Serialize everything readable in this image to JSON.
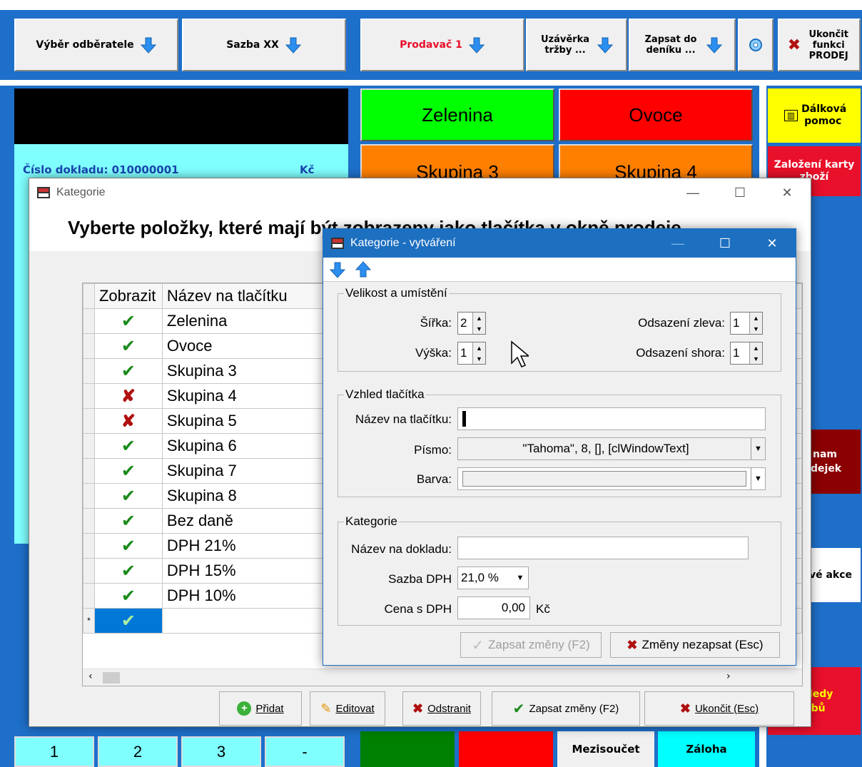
{
  "toolbar": {
    "customer": "Výběr odběratele",
    "rate": "Sazba XX",
    "seller": "Prodavač 1",
    "closing": "Uzávěrka tržby ...",
    "journal": "Zapsat do deníku ...",
    "exit": "Ukončit funkci PRODEJ"
  },
  "doc": {
    "number_label": "Číslo dokladu: 010000001",
    "currency": "Kč"
  },
  "categories_bg": [
    "Zelenina",
    "Ovoce",
    "Skupina 3",
    "Skupina 4"
  ],
  "side": {
    "remote": "Dálková pomoc",
    "card": "Založení karty zboží",
    "sales_partial": "nam dejek",
    "actions_partial": "vé akce",
    "errors_partial": "hledy ybů"
  },
  "bottom_keys": [
    "1",
    "2",
    "3",
    "-"
  ],
  "bottom_labels": {
    "subtotal": "Mezisoučet",
    "deposit": "Záloha"
  },
  "kategorie_window": {
    "title": "Kategorie",
    "heading": "Vyberte položky, které mají být zobrazeny jako tlačítka v okně prodeje",
    "col_show": "Zobrazit",
    "col_name": "Název na tlačítku",
    "rows": [
      {
        "show": true,
        "name": "Zelenina"
      },
      {
        "show": true,
        "name": "Ovoce"
      },
      {
        "show": true,
        "name": "Skupina 3"
      },
      {
        "show": false,
        "name": "Skupina 4"
      },
      {
        "show": false,
        "name": "Skupina 5"
      },
      {
        "show": true,
        "name": "Skupina 6"
      },
      {
        "show": true,
        "name": "Skupina 7"
      },
      {
        "show": true,
        "name": "Skupina 8"
      },
      {
        "show": true,
        "name": "Bez daně"
      },
      {
        "show": true,
        "name": "DPH 21%"
      },
      {
        "show": true,
        "name": "DPH 15%"
      },
      {
        "show": true,
        "name": "DPH 10%"
      }
    ],
    "new_row_marker": "*",
    "buttons": {
      "add": "Přidat",
      "edit": "Editovat",
      "delete": "Odstranit",
      "save": "Zapsat změny (F2)",
      "close": "Ukončit (Esc)"
    }
  },
  "create_window": {
    "title": "Kategorie - vytváření",
    "size_group": "Velikost a umístění",
    "width_label": "Šířka:",
    "width_value": "2",
    "height_label": "Výška:",
    "height_value": "1",
    "left_label": "Odsazení zleva:",
    "left_value": "1",
    "top_label": "Odsazení shora:",
    "top_value": "1",
    "look_group": "Vzhled tlačítka",
    "btn_name_label": "Název na tlačítku:",
    "font_label": "Písmo:",
    "font_value": "\"Tahoma\", 8, [], [clWindowText]",
    "color_label": "Barva:",
    "cat_group": "Kategorie",
    "doc_name_label": "Název na dokladu:",
    "vat_label": "Sazba DPH",
    "vat_value": "21,0 %",
    "price_label": "Cena s DPH",
    "price_value": "0,00",
    "price_unit": "Kč",
    "save_btn": "Zapsat změny (F2)",
    "cancel_btn": "Změny nezapsat (Esc)"
  },
  "colors": {
    "background": "#1e6fc9",
    "green": "#00ff00",
    "red": "#ff0000",
    "orange": "#ff8000",
    "cyan": "#80ffff",
    "yellow": "#ffff00",
    "accent_red": "#e8102a"
  }
}
